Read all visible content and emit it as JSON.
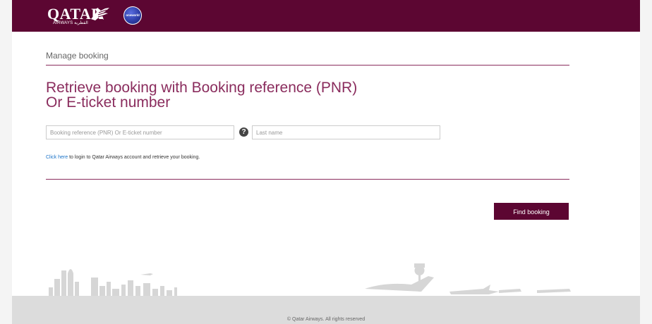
{
  "header": {
    "logo_text": "QATAR",
    "logo_subtext": "AIRWAYS القطرية",
    "alliance_text": "oneworld",
    "brand_color": "#5c0632"
  },
  "breadcrumb": "Manage booking",
  "title": {
    "line1": "Retrieve booking with Booking reference (PNR)",
    "line2": "Or E-ticket number"
  },
  "form": {
    "pnr_placeholder": "Booking reference (PNR) Or E-ticket number",
    "pnr_value": "",
    "help_glyph": "?",
    "lastname_placeholder": "Last name",
    "lastname_value": ""
  },
  "login": {
    "link_text": "Click here",
    "rest_text": " to login to Qatar Airways account and retrieve your booking."
  },
  "find_button_label": "Find booking",
  "footer": {
    "copyright": "© Qatar Airways. All rights reserved"
  }
}
